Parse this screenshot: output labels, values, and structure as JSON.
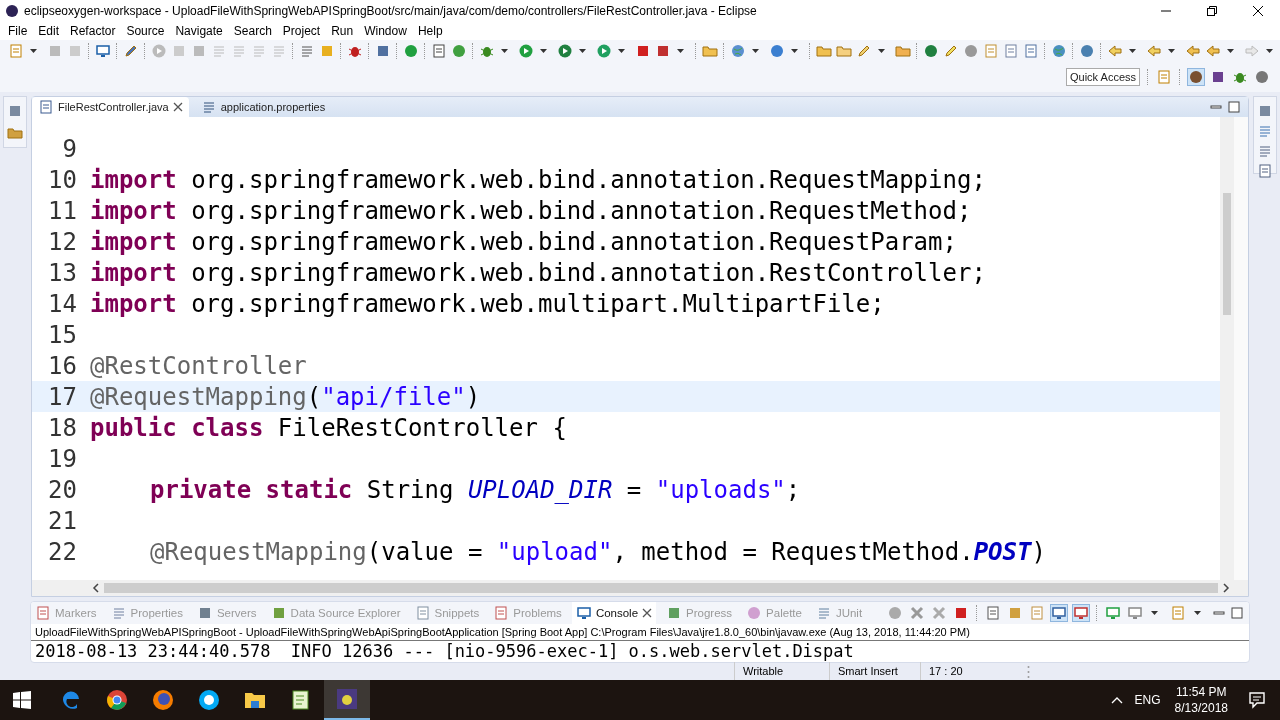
{
  "window": {
    "title": "eclipseoxygen-workspace - UploadFileWithSpringWebAPISpringBoot/src/main/java/com/demo/controllers/FileRestController.java - Eclipse"
  },
  "menu": [
    {
      "label": "File"
    },
    {
      "label": "Edit"
    },
    {
      "label": "Refactor"
    },
    {
      "label": "Source"
    },
    {
      "label": "Navigate"
    },
    {
      "label": "Search"
    },
    {
      "label": "Project"
    },
    {
      "label": "Run"
    },
    {
      "label": "Window"
    },
    {
      "label": "Help"
    }
  ],
  "quick_access": {
    "placeholder": "Quick Access"
  },
  "editor_tabs": [
    {
      "label": "FileRestController.java",
      "selected": true
    },
    {
      "label": "application.properties",
      "selected": false
    }
  ],
  "editor": {
    "lines": [
      {
        "number": "9",
        "current": false
      },
      {
        "number": "10",
        "current": false,
        "tokens": [
          {
            "kind": "kw",
            "text": "import"
          },
          {
            "kind": "plain",
            "text": " org.springframework.web.bind.annotation.RequestMapping;"
          }
        ]
      },
      {
        "number": "11",
        "current": false,
        "tokens": [
          {
            "kind": "kw",
            "text": "import"
          },
          {
            "kind": "plain",
            "text": " org.springframework.web.bind.annotation.RequestMethod;"
          }
        ]
      },
      {
        "number": "12",
        "current": false,
        "tokens": [
          {
            "kind": "kw",
            "text": "import"
          },
          {
            "kind": "plain",
            "text": " org.springframework.web.bind.annotation.RequestParam;"
          }
        ]
      },
      {
        "number": "13",
        "current": false,
        "tokens": [
          {
            "kind": "kw",
            "text": "import"
          },
          {
            "kind": "plain",
            "text": " org.springframework.web.bind.annotation.RestController;"
          }
        ]
      },
      {
        "number": "14",
        "current": false,
        "tokens": [
          {
            "kind": "kw",
            "text": "import"
          },
          {
            "kind": "plain",
            "text": " org.springframework.web.multipart.MultipartFile;"
          }
        ]
      },
      {
        "number": "15",
        "current": false
      },
      {
        "number": "16",
        "current": false,
        "tokens": [
          {
            "kind": "ann",
            "text": "@RestController"
          }
        ]
      },
      {
        "number": "17",
        "current": true,
        "tokens": [
          {
            "kind": "ann",
            "text": "@RequestMapping"
          },
          {
            "kind": "plain",
            "text": "("
          },
          {
            "kind": "str",
            "text": "\"api/file\""
          },
          {
            "kind": "plain",
            "text": ")"
          }
        ]
      },
      {
        "number": "18",
        "current": false,
        "tokens": [
          {
            "kind": "kw",
            "text": "public class"
          },
          {
            "kind": "plain",
            "text": " FileRestController {"
          }
        ]
      },
      {
        "number": "19",
        "current": false
      },
      {
        "number": "20",
        "current": false,
        "indent": true,
        "tokens": [
          {
            "kind": "kw",
            "text": "private static"
          },
          {
            "kind": "plain",
            "text": " String "
          },
          {
            "kind": "field",
            "text": "UPLOAD_DIR"
          },
          {
            "kind": "plain",
            "text": " = "
          },
          {
            "kind": "str",
            "text": "\"uploads\""
          },
          {
            "kind": "plain",
            "text": ";"
          }
        ]
      },
      {
        "number": "21",
        "current": false
      },
      {
        "number": "22",
        "current": false,
        "indent": true,
        "tokens": [
          {
            "kind": "ann",
            "text": "@RequestMapping"
          },
          {
            "kind": "plain",
            "text": "(value = "
          },
          {
            "kind": "str",
            "text": "\"upload\""
          },
          {
            "kind": "plain",
            "text": ", method = RequestMethod."
          },
          {
            "kind": "const",
            "text": "POST"
          },
          {
            "kind": "plain",
            "text": ")"
          }
        ]
      }
    ]
  },
  "view_tabs": [
    {
      "label": "Markers",
      "selected": false
    },
    {
      "label": "Properties",
      "selected": false
    },
    {
      "label": "Servers",
      "selected": false
    },
    {
      "label": "Data Source Explorer",
      "selected": false
    },
    {
      "label": "Snippets",
      "selected": false
    },
    {
      "label": "Problems",
      "selected": false
    },
    {
      "label": "Console",
      "selected": true
    },
    {
      "label": "Progress",
      "selected": false
    },
    {
      "label": "Palette",
      "selected": false
    },
    {
      "label": "JUnit",
      "selected": false
    }
  ],
  "console": {
    "header": "UploadFileWithSpringWebAPISpringBoot - UploadFileWithSpringWebApiSpringBootApplication [Spring Boot App] C:\\Program Files\\Java\\jre1.8.0_60\\bin\\javaw.exe (Aug 13, 2018, 11:44:20 PM)",
    "lines": [
      "2018-08-13 23:44:40.578  INFO 12636 --- [nio-9596-exec-1] o.s.web.servlet.Dispat"
    ]
  },
  "status_bar": {
    "items": [
      "Writable",
      "Smart Insert",
      "17 : 20"
    ]
  },
  "taskbar": {
    "apps": [
      {
        "selected": false
      },
      {
        "selected": false
      },
      {
        "selected": false
      },
      {
        "selected": false
      },
      {
        "selected": false
      },
      {
        "selected": false
      },
      {
        "selected": true
      }
    ],
    "language": "ENG",
    "time": "11:54 PM",
    "date": "8/13/2018"
  }
}
